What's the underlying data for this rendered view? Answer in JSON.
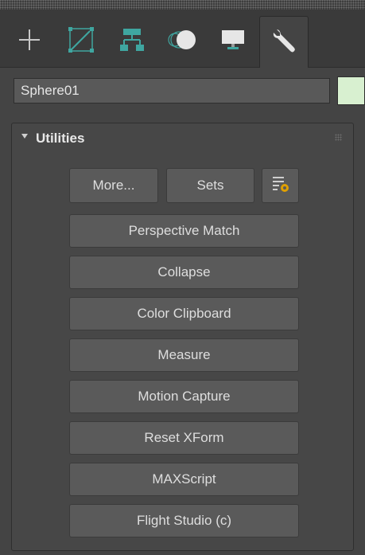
{
  "tabs": [
    {
      "name": "create-tab",
      "icon": "plus-icon"
    },
    {
      "name": "modify-tab",
      "icon": "modify-curve-icon"
    },
    {
      "name": "hierarchy-tab",
      "icon": "hierarchy-icon"
    },
    {
      "name": "motion-tab",
      "icon": "motion-circle-icon"
    },
    {
      "name": "display-tab",
      "icon": "monitor-icon"
    },
    {
      "name": "utilities-tab",
      "icon": "wrench-icon",
      "active": true
    }
  ],
  "object": {
    "name": "Sphere01",
    "color": "#d8f0d0"
  },
  "rollout": {
    "title": "Utilities",
    "more_label": "More...",
    "sets_label": "Sets",
    "configure_icon": "configure-sets-icon"
  },
  "utilities": [
    "Perspective Match",
    "Collapse",
    "Color Clipboard",
    "Measure",
    "Motion Capture",
    "Reset XForm",
    "MAXScript",
    "Flight Studio (c)"
  ]
}
